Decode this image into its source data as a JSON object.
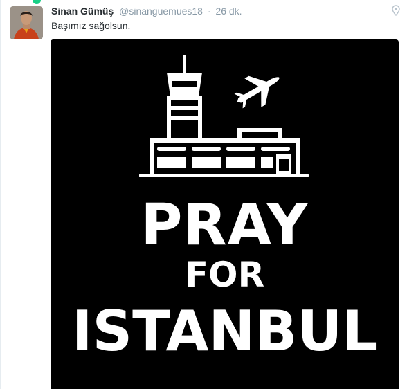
{
  "tweet": {
    "fullname": "Sinan Gümüş",
    "username": "@sinanguemues18",
    "separator": "·",
    "time": "26 dk.",
    "text": "Başımız sağolsun."
  },
  "media": {
    "icon": "airport-tower-plane-icon",
    "line1": "PRAY",
    "line2": "FOR",
    "line3": "ISTANBUL",
    "background": "#000000",
    "foreground": "#ffffff"
  },
  "colors": {
    "name": "#292f33",
    "meta": "#8899a6",
    "dot": "#19cf86"
  }
}
